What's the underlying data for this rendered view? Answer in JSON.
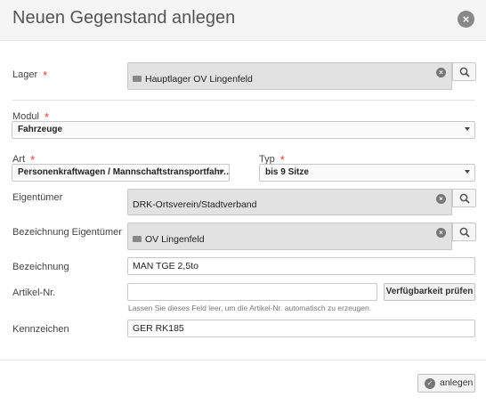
{
  "dialog": {
    "title": "Neuen Gegenstand anlegen"
  },
  "fields": {
    "lager": {
      "label": "Lager",
      "value": "Hauptlager OV Lingenfeld",
      "required_mark": "*"
    },
    "modul": {
      "label": "Modul",
      "value": "Fahrzeuge",
      "required_mark": "*"
    },
    "art": {
      "label": "Art",
      "value": "Personenkraftwagen / Mannschaftstransportfahr…",
      "required_mark": "*"
    },
    "typ": {
      "label": "Typ",
      "value": "bis 9 Sitze",
      "required_mark": "*"
    },
    "eigentuemer": {
      "label": "Eigentümer",
      "value": "DRK-Ortsverein/Stadtverband"
    },
    "bezeichnung_eigentuemer": {
      "label": "Bezeichnung Eigentümer",
      "value": "OV Lingenfeld"
    },
    "bezeichnung": {
      "label": "Bezeichnung",
      "value": "MAN TGE 2,5to"
    },
    "artikel_nr": {
      "label": "Artikel-Nr.",
      "value": "",
      "button": "Verfügbarkeit prüfen",
      "hint": "Lassen Sie dieses Feld leer, um die Artikel-Nr. automatisch zu erzeugen."
    },
    "kennzeichen": {
      "label": "Kennzeichen",
      "value": "GER RK185"
    }
  },
  "footer": {
    "submit_label": "anlegen"
  },
  "icons": {
    "close": "×",
    "clear": "×",
    "check": "✓"
  }
}
